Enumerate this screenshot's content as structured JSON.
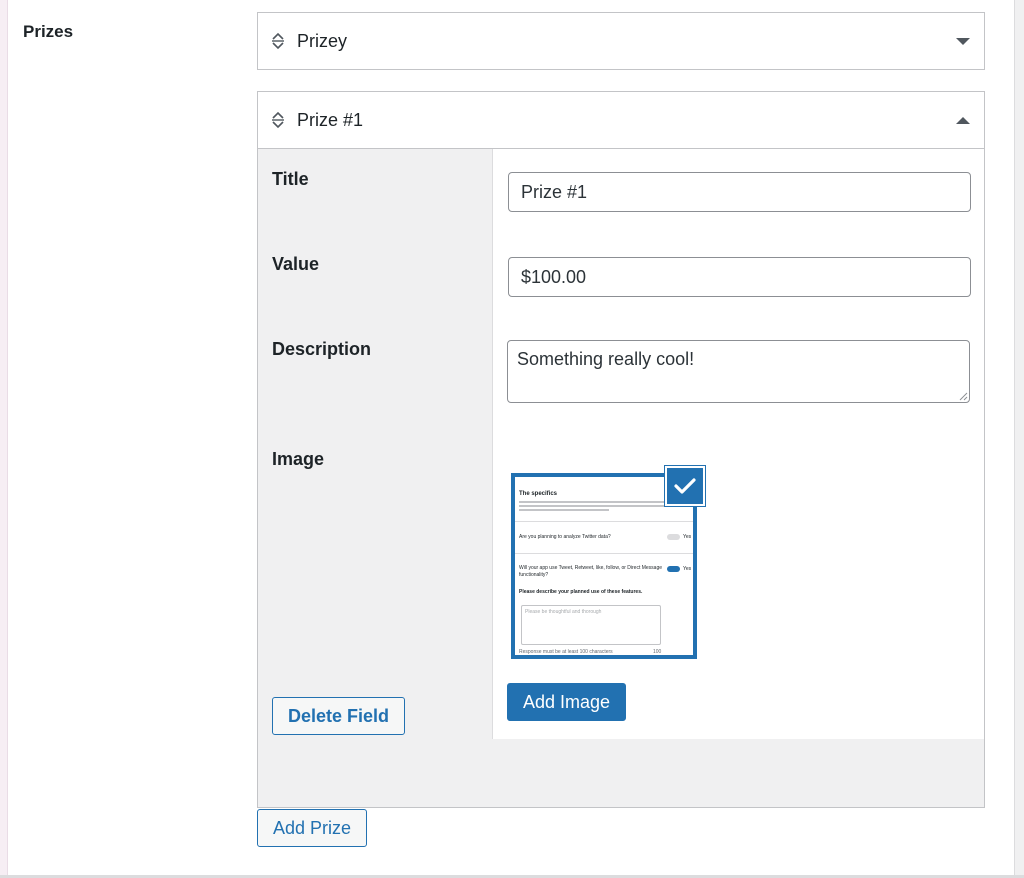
{
  "section": {
    "label": "Prizes"
  },
  "accordions": [
    {
      "title": "Prizey",
      "expanded": false
    },
    {
      "title": "Prize #1",
      "expanded": true
    }
  ],
  "prize": {
    "fields": {
      "title_label": "Title",
      "title_value": "Prize #1",
      "value_label": "Value",
      "value_value": "$100.00",
      "description_label": "Description",
      "description_value": "Something really cool!",
      "image_label": "Image"
    },
    "image_preview": {
      "heading": "The specifics",
      "q1": "Are you planning to analyze Twitter data?",
      "q1_toggle": "Yes",
      "q2": "Will your app use Tweet, Retweet, like, follow, or Direct Message functionality?",
      "q2_toggle": "Yes",
      "q3": "Please describe your planned use of these features.",
      "placeholder": "Please be thoughtful and thorough",
      "footer_left": "Response must be at least 100 characters",
      "footer_right": "100"
    },
    "add_image_label": "Add Image",
    "delete_label": "Delete Field"
  },
  "add_prize_label": "Add Prize",
  "colors": {
    "accent": "#2271b1",
    "border": "#c3c4c7",
    "panel": "#f0f0f1"
  },
  "icons": [
    "sort-arrows-icon",
    "caret-down-icon",
    "caret-up-icon",
    "checkmark-icon",
    "resize-grip-icon"
  ]
}
